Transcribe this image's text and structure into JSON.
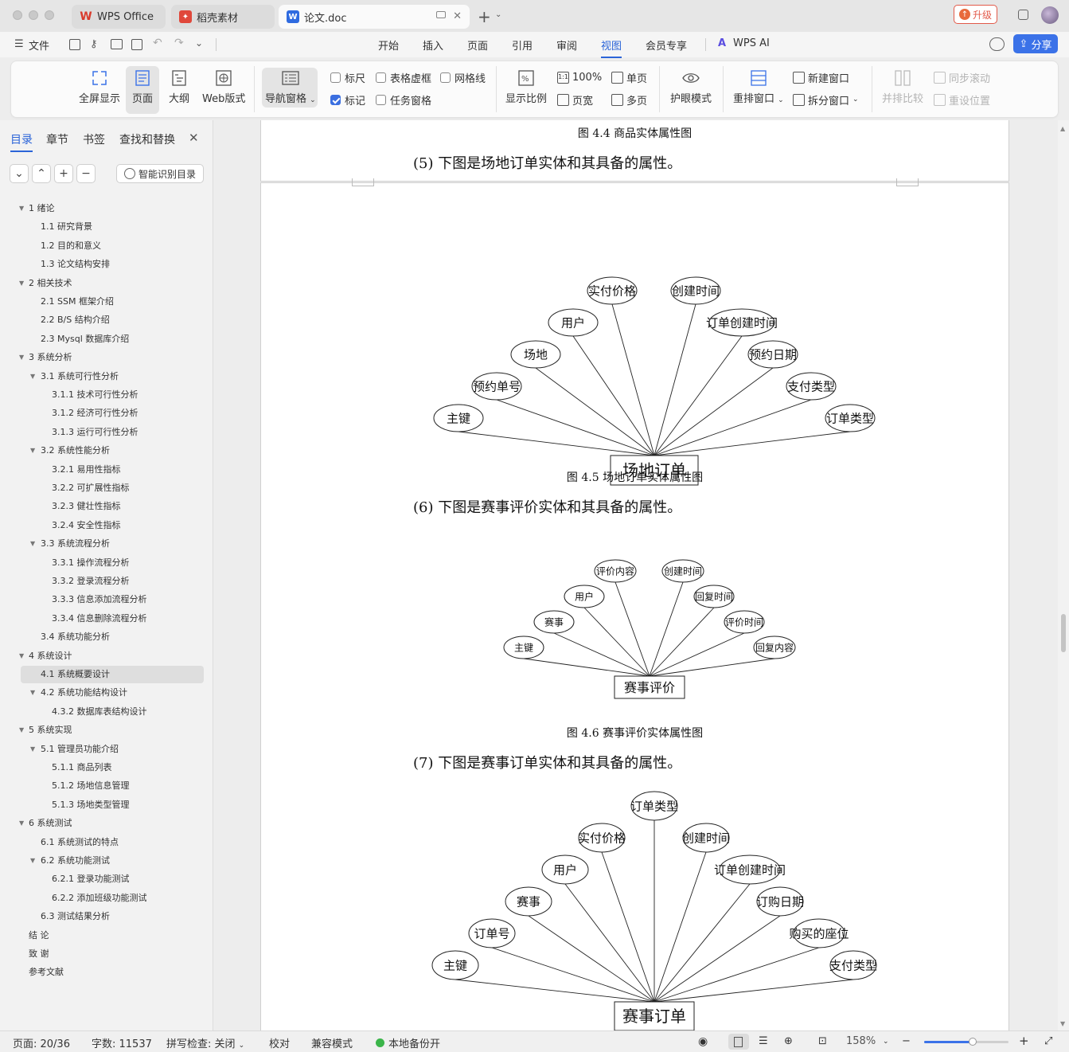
{
  "tabs": [
    {
      "label": "WPS Office",
      "icon": "wps-logo-icon",
      "color": "#d93a2b"
    },
    {
      "label": "稻壳素材",
      "icon": "daoke-logo-icon",
      "color": "#e0483b"
    },
    {
      "label": "论文.doc",
      "icon": "word-doc-icon",
      "color": "#2f6be0"
    }
  ],
  "titlebar": {
    "upgrade_label": "升级"
  },
  "menu": {
    "file_label": "文件",
    "items": [
      "开始",
      "插入",
      "页面",
      "引用",
      "审阅",
      "视图",
      "会员专享"
    ],
    "active": "视图",
    "ai_label": "WPS AI",
    "share_label": "分享"
  },
  "ribbon": {
    "fullscreen": "全屏显示",
    "page": "页面",
    "outline": "大纲",
    "web": "Web版式",
    "nav_pane": "导航窗格",
    "ruler": "标尺",
    "table_grid": "表格虚框",
    "gridlines": "网格线",
    "marks": "标记",
    "task_pane": "任务窗格",
    "zoom_ratio": "显示比例",
    "hundred": "100%",
    "page_width": "页宽",
    "single_page": "单页",
    "multi_page": "多页",
    "eye_mode": "护眼模式",
    "rearrange": "重排窗口",
    "new_window": "新建窗口",
    "split_window": "拆分窗口",
    "side_by_side": "并排比较",
    "sync_scroll": "同步滚动",
    "reset_position": "重设位置"
  },
  "sidebar": {
    "tabs": [
      "目录",
      "章节",
      "书签",
      "查找和替换"
    ],
    "smart_toc": "智能识别目录",
    "toc": [
      {
        "label": "1  绪论",
        "level": 1
      },
      {
        "label": "1.1  研究背景",
        "level": 2
      },
      {
        "label": "1.2  目的和意义",
        "level": 2
      },
      {
        "label": "1.3  论文结构安排",
        "level": 2
      },
      {
        "label": "2  相关技术",
        "level": 1
      },
      {
        "label": "2.1 SSM 框架介绍",
        "level": 2
      },
      {
        "label": "2.2 B/S 结构介绍",
        "level": 2
      },
      {
        "label": "2.3 Mysql 数据库介绍",
        "level": 2
      },
      {
        "label": "3  系统分析",
        "level": 1
      },
      {
        "label": "3.1  系统可行性分析",
        "level": 2,
        "expandable": true
      },
      {
        "label": "3.1.1  技术可行性分析",
        "level": 3
      },
      {
        "label": "3.1.2  经济可行性分析",
        "level": 3
      },
      {
        "label": "3.1.3  运行可行性分析",
        "level": 3
      },
      {
        "label": "3.2  系统性能分析",
        "level": 2,
        "expandable": true
      },
      {
        "label": "3.2.1  易用性指标",
        "level": 3
      },
      {
        "label": "3.2.2  可扩展性指标",
        "level": 3
      },
      {
        "label": "3.2.3  健壮性指标",
        "level": 3
      },
      {
        "label": "3.2.4  安全性指标",
        "level": 3
      },
      {
        "label": "3.3  系统流程分析",
        "level": 2,
        "expandable": true
      },
      {
        "label": "3.3.1  操作流程分析",
        "level": 3
      },
      {
        "label": "3.3.2  登录流程分析",
        "level": 3
      },
      {
        "label": "3.3.3  信息添加流程分析",
        "level": 3
      },
      {
        "label": "3.3.4  信息删除流程分析",
        "level": 3
      },
      {
        "label": "3.4  系统功能分析",
        "level": 2
      },
      {
        "label": "4  系统设计",
        "level": 1
      },
      {
        "label": "4.1  系统概要设计",
        "level": 2,
        "selected": true
      },
      {
        "label": "4.2  系统功能结构设计",
        "level": 2,
        "expandable": true
      },
      {
        "label": "4.3.2  数据库表结构设计",
        "level": 3
      },
      {
        "label": "5  系统实现",
        "level": 1
      },
      {
        "label": "5.1  管理员功能介绍",
        "level": 2,
        "expandable": true
      },
      {
        "label": "5.1.1  商品列表",
        "level": 3
      },
      {
        "label": "5.1.2  场地信息管理",
        "level": 3
      },
      {
        "label": "5.1.3 场地类型管理",
        "level": 3
      },
      {
        "label": "6  系统测试",
        "level": 1
      },
      {
        "label": "6.1  系统测试的特点",
        "level": 2
      },
      {
        "label": "6.2  系统功能测试",
        "level": 2,
        "expandable": true
      },
      {
        "label": "6.2.1  登录功能测试",
        "level": 3
      },
      {
        "label": "6.2.2  添加班级功能测试",
        "level": 3
      },
      {
        "label": "6.3  测试结果分析",
        "level": 2
      },
      {
        "label": "结    论",
        "level": 1,
        "plain": true
      },
      {
        "label": "致    谢",
        "level": 1,
        "plain": true
      },
      {
        "label": "参考文献",
        "level": 1,
        "plain": true
      }
    ]
  },
  "document": {
    "caption_44": "图 4.4  商品实体属性图",
    "para_5": "(5)  下图是场地订单实体和其具备的属性。",
    "diagram_45": {
      "entity": "场地订单",
      "attributes": [
        "主键",
        "预约单号",
        "场地",
        "用户",
        "实付价格",
        "创建时间",
        "订单创建时间",
        "预约日期",
        "支付类型",
        "订单类型"
      ]
    },
    "caption_45": "图 4.5  场地订单实体属性图",
    "para_6": "(6)  下图是赛事评价实体和其具备的属性。",
    "diagram_46": {
      "entity": "赛事评价",
      "attributes": [
        "主键",
        "赛事",
        "用户",
        "评价内容",
        "创建时间",
        "回复时间",
        "评价时间",
        "回复内容"
      ]
    },
    "caption_46": "图 4.6  赛事评价实体属性图",
    "para_7": "(7)  下图是赛事订单实体和其具备的属性。",
    "diagram_47": {
      "entity": "赛事订单",
      "attributes": [
        "主键",
        "订单号",
        "赛事",
        "用户",
        "实付价格",
        "订单类型",
        "创建时间",
        "订单创建时间",
        "订购日期",
        "购买的座位",
        "支付类型"
      ]
    }
  },
  "status": {
    "page": "页面: 20/36",
    "words": "字数: 11537",
    "spell": "拼写检查: 关闭",
    "proof": "校对",
    "compat": "兼容模式",
    "backup": "本地备份开",
    "zoom": "158%",
    "zoom_fraction": 0.58
  }
}
